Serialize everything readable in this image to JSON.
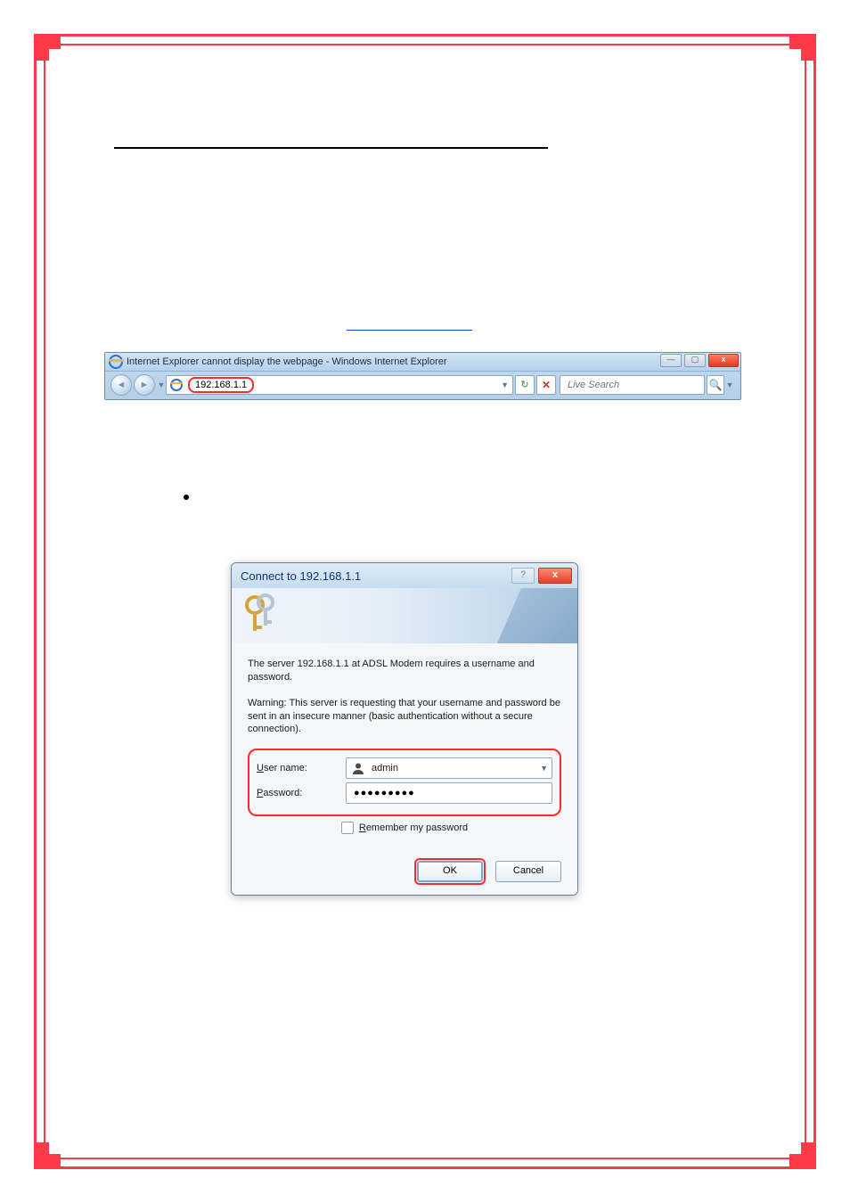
{
  "ie": {
    "window_title": "Internet Explorer cannot display the webpage - Windows Internet Explorer",
    "address": "192.168.1.1",
    "search_placeholder": "Live Search",
    "btn_min": "—",
    "btn_max": "▢",
    "btn_close": "x",
    "back_glyph": "◄",
    "fwd_glyph": "►",
    "dd_glyph": "▼",
    "refresh_glyph": "↻",
    "stop_glyph": "✕",
    "mag_glyph": "🔍"
  },
  "dialog": {
    "title": "Connect to 192.168.1.1",
    "help_glyph": "?",
    "close_glyph": "x",
    "msg1": "The server 192.168.1.1 at ADSL Modem requires a username and password.",
    "msg2": "Warning: This server is requesting that your username and password be sent in an insecure manner (basic authentication without a secure connection).",
    "labels": {
      "user_prefix": "U",
      "user_rest": "ser name:",
      "pass_prefix": "P",
      "pass_rest": "assword:",
      "remember_prefix": "R",
      "remember_rest": "emember my password"
    },
    "values": {
      "username": "admin",
      "password_masked": "●●●●●●●●●",
      "dd_glyph": "▼"
    },
    "buttons": {
      "ok": "OK",
      "cancel": "Cancel"
    }
  }
}
